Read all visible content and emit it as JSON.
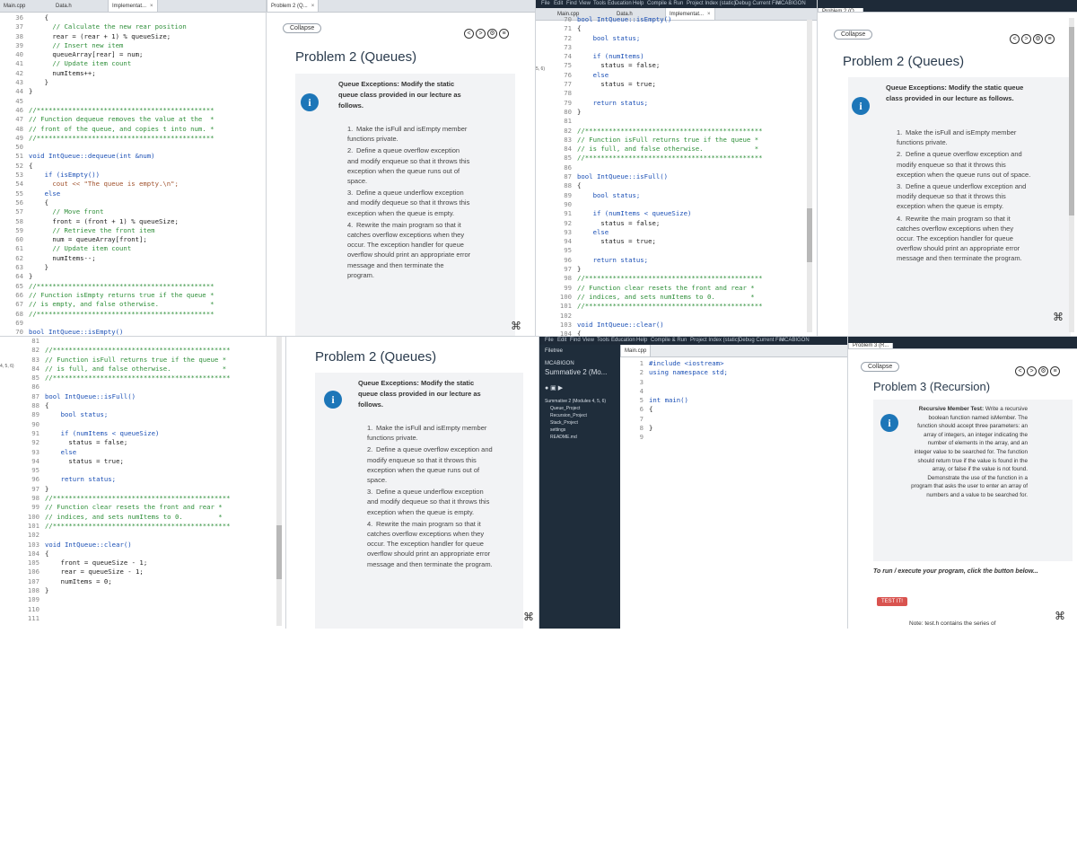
{
  "panel1": {
    "tabs": [
      "Main.cpp",
      "Data.h",
      "Implementat..."
    ],
    "close_glyph": "×",
    "lines": [
      {
        "n": "36",
        "t": "    {"
      },
      {
        "n": "37",
        "t": "      // Calculate the new rear position"
      },
      {
        "n": "38",
        "t": "      rear = (rear + 1) % queueSize;"
      },
      {
        "n": "39",
        "t": "      // Insert new item"
      },
      {
        "n": "40",
        "t": "      queueArray[rear] = num;"
      },
      {
        "n": "41",
        "t": "      // Update item count"
      },
      {
        "n": "42",
        "t": "      numItems++;"
      },
      {
        "n": "43",
        "t": "    }"
      },
      {
        "n": "44",
        "t": "}"
      },
      {
        "n": "45",
        "t": ""
      },
      {
        "n": "46",
        "t": "//*********************************************"
      },
      {
        "n": "47",
        "t": "// Function dequeue removes the value at the  *"
      },
      {
        "n": "48",
        "t": "// front of the queue, and copies t into num. *"
      },
      {
        "n": "49",
        "t": "//*********************************************"
      },
      {
        "n": "50",
        "t": ""
      },
      {
        "n": "51",
        "t": "void IntQueue::dequeue(int &num)"
      },
      {
        "n": "52",
        "t": "{"
      },
      {
        "n": "53",
        "t": "    if (isEmpty())"
      },
      {
        "n": "54",
        "t": "      cout << \"The queue is empty.\\n\";"
      },
      {
        "n": "55",
        "t": "    else"
      },
      {
        "n": "56",
        "t": "    {"
      },
      {
        "n": "57",
        "t": "      // Move front"
      },
      {
        "n": "58",
        "t": "      front = (front + 1) % queueSize;"
      },
      {
        "n": "59",
        "t": "      // Retrieve the front item"
      },
      {
        "n": "60",
        "t": "      num = queueArray[front];"
      },
      {
        "n": "61",
        "t": "      // Update item count"
      },
      {
        "n": "62",
        "t": "      numItems--;"
      },
      {
        "n": "63",
        "t": "    }"
      },
      {
        "n": "64",
        "t": "}"
      },
      {
        "n": "65",
        "t": "//*********************************************"
      },
      {
        "n": "66",
        "t": "// Function isEmpty returns true if the queue *"
      },
      {
        "n": "67",
        "t": "// is empty, and false otherwise.             *"
      },
      {
        "n": "68",
        "t": "//*********************************************"
      },
      {
        "n": "69",
        "t": ""
      },
      {
        "n": "70",
        "t": "bool IntQueue::isEmpty()"
      }
    ]
  },
  "instructions": {
    "tab_label": "Problem 2 (Q...",
    "collapse": "Collapse",
    "title": "Problem 2 (Queues)",
    "card_heading": "Queue Exceptions: Modify the static queue class provided in our lecture as follows.",
    "steps": [
      {
        "num": "1.",
        "text": "Make the isFull and isEmpty member functions private."
      },
      {
        "num": "2.",
        "text": "Define a queue overflow exception and modify enqueue so that it throws this exception when the queue runs out of space."
      },
      {
        "num": "3.",
        "text": "Define a queue underflow exception and modify dequeue so that it throws this exception when the queue is empty."
      },
      {
        "num": "4.",
        "text": "Rewrite the main program so that it catches overflow exceptions when they occur. The exception handler for queue overflow should print an appropriate error message and then terminate the program."
      }
    ],
    "nav": [
      "<",
      ">",
      "⚙",
      "≡"
    ]
  },
  "panel3": {
    "menu": [
      "File",
      "Edit",
      "Find",
      "View",
      "Tools",
      "Education",
      "Help",
      "Compile & Run",
      "Project Index (static)",
      "Debug Current File",
      "MCABIGON"
    ],
    "tabs": [
      "Main.cpp",
      "Data.h",
      "Implementat..."
    ],
    "left_stub": "5, 6)",
    "lines": [
      {
        "n": "70",
        "t": "bool IntQueue::isEmpty()"
      },
      {
        "n": "71",
        "t": "{"
      },
      {
        "n": "72",
        "t": "    bool status;"
      },
      {
        "n": "73",
        "t": ""
      },
      {
        "n": "74",
        "t": "    if (numItems)"
      },
      {
        "n": "75",
        "t": "      status = false;"
      },
      {
        "n": "76",
        "t": "    else"
      },
      {
        "n": "77",
        "t": "      status = true;"
      },
      {
        "n": "78",
        "t": ""
      },
      {
        "n": "79",
        "t": "    return status;"
      },
      {
        "n": "80",
        "t": "}"
      },
      {
        "n": "81",
        "t": ""
      },
      {
        "n": "82",
        "t": "//*********************************************"
      },
      {
        "n": "83",
        "t": "// Function isFull returns true if the queue *"
      },
      {
        "n": "84",
        "t": "// is full, and false otherwise.             *"
      },
      {
        "n": "85",
        "t": "//*********************************************"
      },
      {
        "n": "86",
        "t": ""
      },
      {
        "n": "87",
        "t": "bool IntQueue::isFull()"
      },
      {
        "n": "88",
        "t": "{"
      },
      {
        "n": "89",
        "t": "    bool status;"
      },
      {
        "n": "90",
        "t": ""
      },
      {
        "n": "91",
        "t": "    if (numItems < queueSize)"
      },
      {
        "n": "92",
        "t": "      status = false;"
      },
      {
        "n": "93",
        "t": "    else"
      },
      {
        "n": "94",
        "t": "      status = true;"
      },
      {
        "n": "95",
        "t": ""
      },
      {
        "n": "96",
        "t": "    return status;"
      },
      {
        "n": "97",
        "t": "}"
      },
      {
        "n": "98",
        "t": "//*********************************************"
      },
      {
        "n": "99",
        "t": "// Function clear resets the front and rear *"
      },
      {
        "n": "100",
        "t": "// indices, and sets numItems to 0.         *"
      },
      {
        "n": "101",
        "t": "//*********************************************"
      },
      {
        "n": "102",
        "t": ""
      },
      {
        "n": "103",
        "t": "void IntQueue::clear()"
      },
      {
        "n": "104",
        "t": "{"
      }
    ]
  },
  "panel5": {
    "lines": [
      {
        "n": "81",
        "t": ""
      },
      {
        "n": "82",
        "t": "//*********************************************"
      },
      {
        "n": "83",
        "t": "// Function isFull returns true if the queue *"
      },
      {
        "n": "84",
        "t": "// is full, and false otherwise.             *"
      },
      {
        "n": "85",
        "t": "//*********************************************"
      },
      {
        "n": "86",
        "t": ""
      },
      {
        "n": "87",
        "t": "bool IntQueue::isFull()"
      },
      {
        "n": "88",
        "t": "{"
      },
      {
        "n": "89",
        "t": "    bool status;"
      },
      {
        "n": "90",
        "t": ""
      },
      {
        "n": "91",
        "t": "    if (numItems < queueSize)"
      },
      {
        "n": "92",
        "t": "      status = false;"
      },
      {
        "n": "93",
        "t": "    else"
      },
      {
        "n": "94",
        "t": "      status = true;"
      },
      {
        "n": "95",
        "t": ""
      },
      {
        "n": "96",
        "t": "    return status;"
      },
      {
        "n": "97",
        "t": "}"
      },
      {
        "n": "98",
        "t": "//*********************************************"
      },
      {
        "n": "99",
        "t": "// Function clear resets the front and rear *"
      },
      {
        "n": "100",
        "t": "// indices, and sets numItems to 0.         *"
      },
      {
        "n": "101",
        "t": "//*********************************************"
      },
      {
        "n": "102",
        "t": ""
      },
      {
        "n": "103",
        "t": "void IntQueue::clear()"
      },
      {
        "n": "104",
        "t": "{"
      },
      {
        "n": "105",
        "t": "    front = queueSize - 1;"
      },
      {
        "n": "106",
        "t": "    rear = queueSize - 1;"
      },
      {
        "n": "107",
        "t": "    numItems = 0;"
      },
      {
        "n": "108",
        "t": "}"
      },
      {
        "n": "109",
        "t": ""
      },
      {
        "n": "110",
        "t": ""
      },
      {
        "n": "111",
        "t": ""
      }
    ],
    "left_stub": "4, 5, 6)"
  },
  "panel7": {
    "filetree_label": "Filetree",
    "project": "MCABIGON",
    "title": "Summative 2 (Mo...",
    "items": [
      "Summative 2 (Modules 4, 5, 6)",
      "Queue_Project",
      "Recursion_Project",
      "Stack_Project",
      "settings",
      "README.md"
    ],
    "tab": "Main.cpp",
    "lines": [
      {
        "n": "1",
        "t": "#include <iostream>"
      },
      {
        "n": "2",
        "t": "using namespace std;"
      },
      {
        "n": "3",
        "t": ""
      },
      {
        "n": "4",
        "t": ""
      },
      {
        "n": "5",
        "t": "int main()"
      },
      {
        "n": "6",
        "t": "{"
      },
      {
        "n": "7",
        "t": ""
      },
      {
        "n": "8",
        "t": "}"
      },
      {
        "n": "9",
        "t": ""
      }
    ]
  },
  "panel8": {
    "tab_label": "Problem 3 (R...",
    "collapse": "Collapse",
    "title": "Problem 3 (Recursion)",
    "card_heading": "Recursive Member Test:",
    "card_text": "Write a recursive boolean function named isMember. The function should accept three parameters: an array of integers, an integer indicating the number of elements in the array, and an integer value to be searched for. The function should return true if the value is found in the array, or false if the value is not found. Demonstrate the use of the function in a program that asks the user to enter an array of numbers and a value to be searched for.",
    "run_text": "To run / execute your program, click the button below...",
    "test_button": "TEST IT!",
    "note": "Note: test.h contains the series of"
  }
}
